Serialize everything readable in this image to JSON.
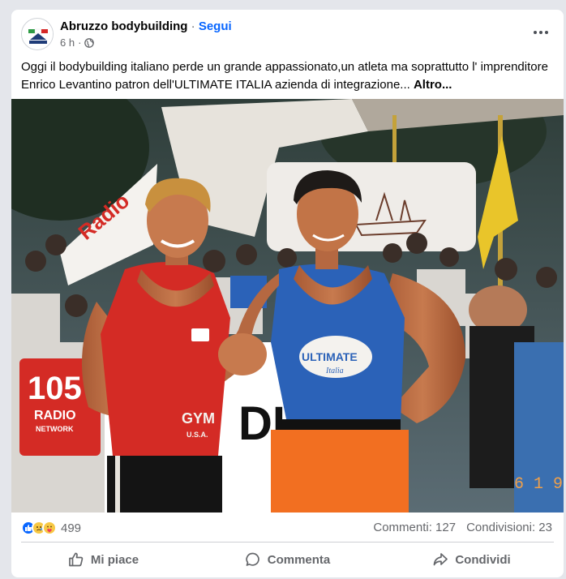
{
  "post": {
    "page_name": "Abruzzo bodybuilding",
    "separator": " · ",
    "follow_label": "Segui",
    "time": "6 h",
    "time_sep": "·",
    "privacy_icon": "globe-icon",
    "more_icon": "more-options-icon",
    "text": "Oggi il bodybuilding italiano perde un grande appassionato,un atleta ma soprattutto l' imprenditore Enrico Levantino patron dell'ULTIMATE ITALIA azienda di integrazione...",
    "see_more": "Altro..."
  },
  "photo": {
    "banner_105": "105",
    "banner_radio": "RADIO",
    "banner_network": "NETWORK",
    "banner_dio": "DIO",
    "shirt_left": "GYM",
    "shirt_left_sub": "U.S.A.",
    "shirt_right": "ULTIMATE",
    "shirt_right_sub": "Italia",
    "timestamp_mark": "6 1 9"
  },
  "engagement": {
    "reaction_icons": [
      "like-icon",
      "sad-icon",
      "care-icon"
    ],
    "reaction_count": "499",
    "comments": "Commenti: 127",
    "shares": "Condivisioni: 23"
  },
  "actions": {
    "like": "Mi piace",
    "comment": "Commenta",
    "share": "Condividi"
  },
  "colors": {
    "link_blue": "#0866ff",
    "secondary_text": "#65676b",
    "red_tank": "#d42b25",
    "blue_tank": "#2b62b8",
    "orange_pants": "#f26f21"
  }
}
